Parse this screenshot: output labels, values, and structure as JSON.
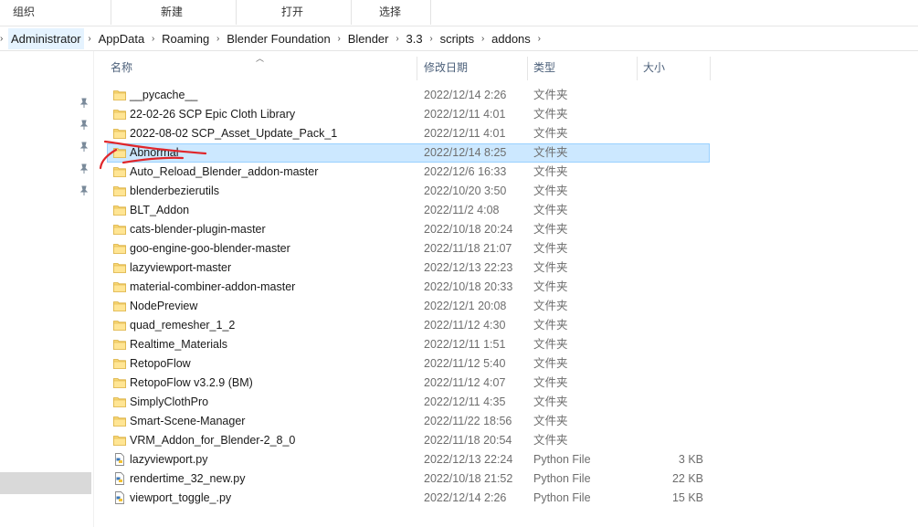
{
  "ribbon": {
    "groups": [
      {
        "label": "组织"
      },
      {
        "label": "新建"
      },
      {
        "label": "打开"
      },
      {
        "label": "选择"
      }
    ]
  },
  "address": {
    "crumbs": [
      "Administrator",
      "AppData",
      "Roaming",
      "Blender Foundation",
      "Blender",
      "3.3",
      "scripts",
      "addons"
    ]
  },
  "columns": {
    "name": "名称",
    "date": "修改日期",
    "type": "类型",
    "size": "大小"
  },
  "files": [
    {
      "name": "__pycache__",
      "date": "2022/12/14 2:26",
      "type": "文件夹",
      "size": "",
      "kind": "folder-icon"
    },
    {
      "name": "22-02-26 SCP Epic Cloth Library",
      "date": "2022/12/11 4:01",
      "type": "文件夹",
      "size": "",
      "kind": "folder-icon"
    },
    {
      "name": "2022-08-02 SCP_Asset_Update_Pack_1",
      "date": "2022/12/11 4:01",
      "type": "文件夹",
      "size": "",
      "kind": "folder-icon"
    },
    {
      "name": "Abnormal",
      "date": "2022/12/14 8:25",
      "type": "文件夹",
      "size": "",
      "kind": "folder-icon",
      "selected": true
    },
    {
      "name": "Auto_Reload_Blender_addon-master",
      "date": "2022/12/6 16:33",
      "type": "文件夹",
      "size": "",
      "kind": "folder-icon"
    },
    {
      "name": "blenderbezierutils",
      "date": "2022/10/20 3:50",
      "type": "文件夹",
      "size": "",
      "kind": "folder-icon"
    },
    {
      "name": "BLT_Addon",
      "date": "2022/11/2 4:08",
      "type": "文件夹",
      "size": "",
      "kind": "folder-icon"
    },
    {
      "name": "cats-blender-plugin-master",
      "date": "2022/10/18 20:24",
      "type": "文件夹",
      "size": "",
      "kind": "folder-icon"
    },
    {
      "name": "goo-engine-goo-blender-master",
      "date": "2022/11/18 21:07",
      "type": "文件夹",
      "size": "",
      "kind": "folder-icon"
    },
    {
      "name": "lazyviewport-master",
      "date": "2022/12/13 22:23",
      "type": "文件夹",
      "size": "",
      "kind": "folder-icon"
    },
    {
      "name": "material-combiner-addon-master",
      "date": "2022/10/18 20:33",
      "type": "文件夹",
      "size": "",
      "kind": "folder-icon"
    },
    {
      "name": "NodePreview",
      "date": "2022/12/1 20:08",
      "type": "文件夹",
      "size": "",
      "kind": "folder-icon"
    },
    {
      "name": "quad_remesher_1_2",
      "date": "2022/11/12 4:30",
      "type": "文件夹",
      "size": "",
      "kind": "folder-icon"
    },
    {
      "name": "Realtime_Materials",
      "date": "2022/12/11 1:51",
      "type": "文件夹",
      "size": "",
      "kind": "folder-icon"
    },
    {
      "name": "RetopoFlow",
      "date": "2022/11/12 5:40",
      "type": "文件夹",
      "size": "",
      "kind": "folder-icon"
    },
    {
      "name": "RetopoFlow v3.2.9 (BM)",
      "date": "2022/11/12 4:07",
      "type": "文件夹",
      "size": "",
      "kind": "folder-icon"
    },
    {
      "name": "SimplyClothPro",
      "date": "2022/12/11 4:35",
      "type": "文件夹",
      "size": "",
      "kind": "folder-icon"
    },
    {
      "name": "Smart-Scene-Manager",
      "date": "2022/11/22 18:56",
      "type": "文件夹",
      "size": "",
      "kind": "folder-icon"
    },
    {
      "name": "VRM_Addon_for_Blender-2_8_0",
      "date": "2022/11/18 20:54",
      "type": "文件夹",
      "size": "",
      "kind": "folder-icon"
    },
    {
      "name": "lazyviewport.py",
      "date": "2022/12/13 22:24",
      "type": "Python File",
      "size": "3 KB",
      "kind": "python-file-icon"
    },
    {
      "name": "rendertime_32_new.py",
      "date": "2022/10/18 21:52",
      "type": "Python File",
      "size": "22 KB",
      "kind": "python-file-icon"
    },
    {
      "name": "viewport_toggle_.py",
      "date": "2022/12/14 2:26",
      "type": "Python File",
      "size": "15 KB",
      "kind": "python-file-icon"
    }
  ],
  "colors": {
    "selection_bg": "#cce8ff",
    "selection_border": "#99d1ff",
    "folder": "#f8d775",
    "annotation": "#e0262a"
  }
}
